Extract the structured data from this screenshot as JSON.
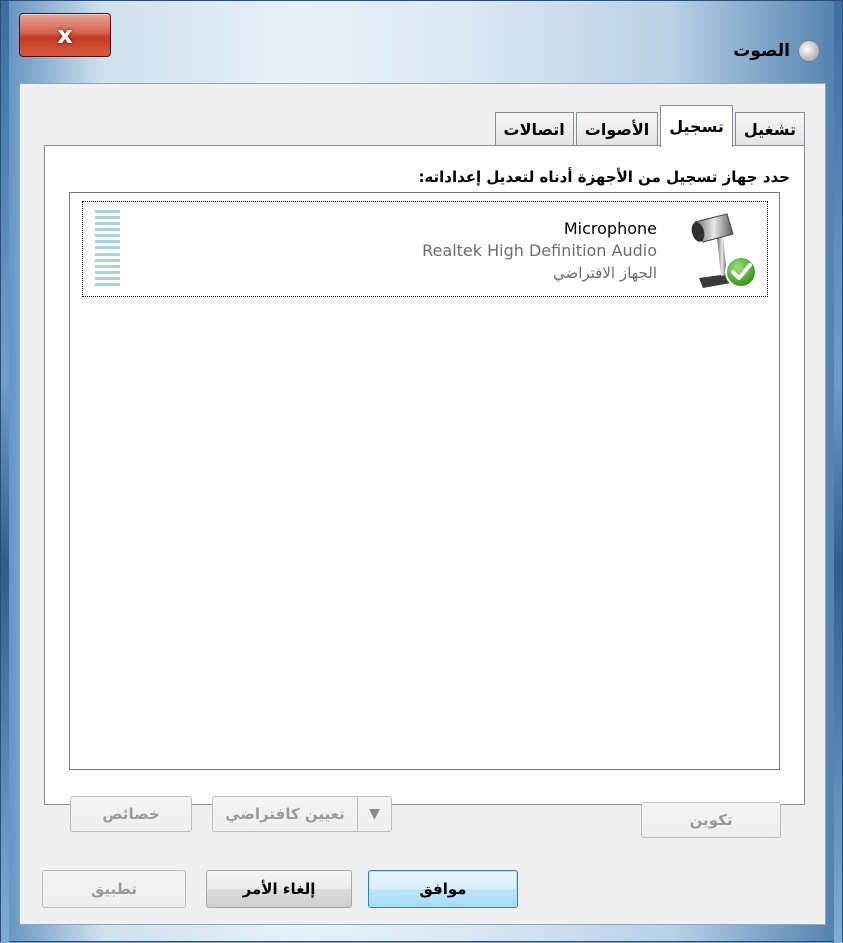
{
  "window": {
    "title": "الصوت",
    "close_label": "x"
  },
  "tabs": [
    {
      "label": "تشغيل",
      "active": false
    },
    {
      "label": "تسجيل",
      "active": true
    },
    {
      "label": "الأصوات",
      "active": false
    },
    {
      "label": "اتصالات",
      "active": false
    }
  ],
  "instruction": "حدد جهاز تسجيل من الأجهزة أدناه لتعديل إعداداته:",
  "device": {
    "name": "Microphone",
    "driver": "Realtek High Definition Audio",
    "status": "الجهاز الافتراضي",
    "icon": "microphone-icon",
    "status_icon": "checkmark-icon",
    "level": 0
  },
  "buttons": {
    "configure": "تكوين",
    "set_default": "تعيين كافتراضي",
    "properties": "خصائص",
    "ok": "موافق",
    "cancel": "إلغاء الأمر",
    "apply": "تطبيق"
  }
}
